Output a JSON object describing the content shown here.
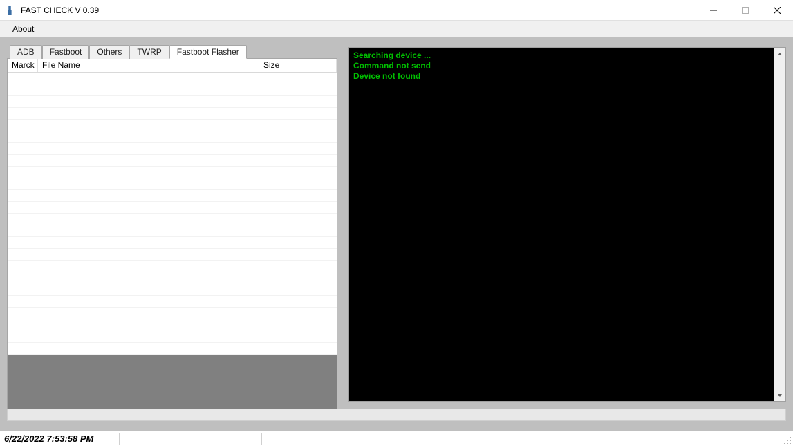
{
  "window": {
    "title": "FAST CHECK     V 0.39"
  },
  "menu": {
    "about": "About"
  },
  "tabs": [
    {
      "label": "ADB",
      "active": false
    },
    {
      "label": "Fastboot",
      "active": false
    },
    {
      "label": "Others",
      "active": false
    },
    {
      "label": "TWRP",
      "active": false
    },
    {
      "label": "Fastboot Flasher",
      "active": true
    }
  ],
  "grid": {
    "columns": {
      "marck": "Marck",
      "file_name": "File Name",
      "size": "Size"
    },
    "rows": []
  },
  "console": {
    "lines": [
      "Searching device ...",
      "Command not send",
      "Device  not found"
    ]
  },
  "status": {
    "datetime": "6/22/2022 7:53:58 PM"
  },
  "colors": {
    "console_bg": "#000000",
    "console_fg": "#00c000",
    "client_bg": "#bfbfbf"
  }
}
